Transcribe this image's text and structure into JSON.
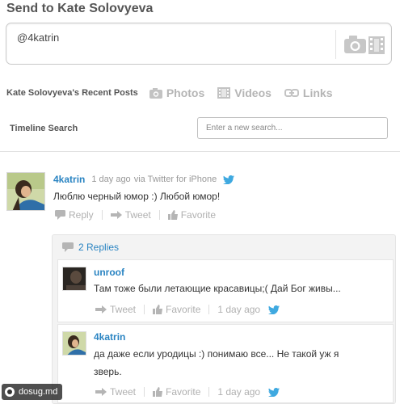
{
  "header": {
    "title": "Send to Kate Solovyeva"
  },
  "compose": {
    "text": "@4katrin",
    "camera_icon": "camera-icon"
  },
  "recent": {
    "label": "Kate Solovyeva's Recent Posts",
    "tabs": [
      {
        "label": "Photos",
        "icon": "photo-icon"
      },
      {
        "label": "Videos",
        "icon": "video-icon"
      },
      {
        "label": "Links",
        "icon": "link-icon"
      }
    ]
  },
  "search": {
    "label": "Timeline Search",
    "placeholder": "Enter a new search..."
  },
  "tweet": {
    "username": "4katrin",
    "time": "1 day ago",
    "source": "via Twitter for iPhone",
    "text": "Люблю черный юмор :) Любой юмор!",
    "actions": {
      "reply": "Reply",
      "retweet": "Tweet",
      "favorite": "Favorite"
    }
  },
  "replies": {
    "count_label": "2 Replies",
    "items": [
      {
        "username": "unroof",
        "text": "Там тоже были летающие красавицы;( Дай Бог живы...",
        "retweet": "Tweet",
        "favorite": "Favorite",
        "time": "1 day ago"
      },
      {
        "username": "4katrin",
        "text_line1": "да даже если уродицы :) понимаю все... Не такой уж я",
        "text_line2": "зверь.",
        "retweet": "Tweet",
        "favorite": "Favorite",
        "time": "1 day ago"
      }
    ]
  },
  "watermark": {
    "text": "dosug.md"
  },
  "colors": {
    "link_blue": "#2a84c2",
    "twitter_bird": "#3fa9e0",
    "muted": "#b0b0b0"
  }
}
